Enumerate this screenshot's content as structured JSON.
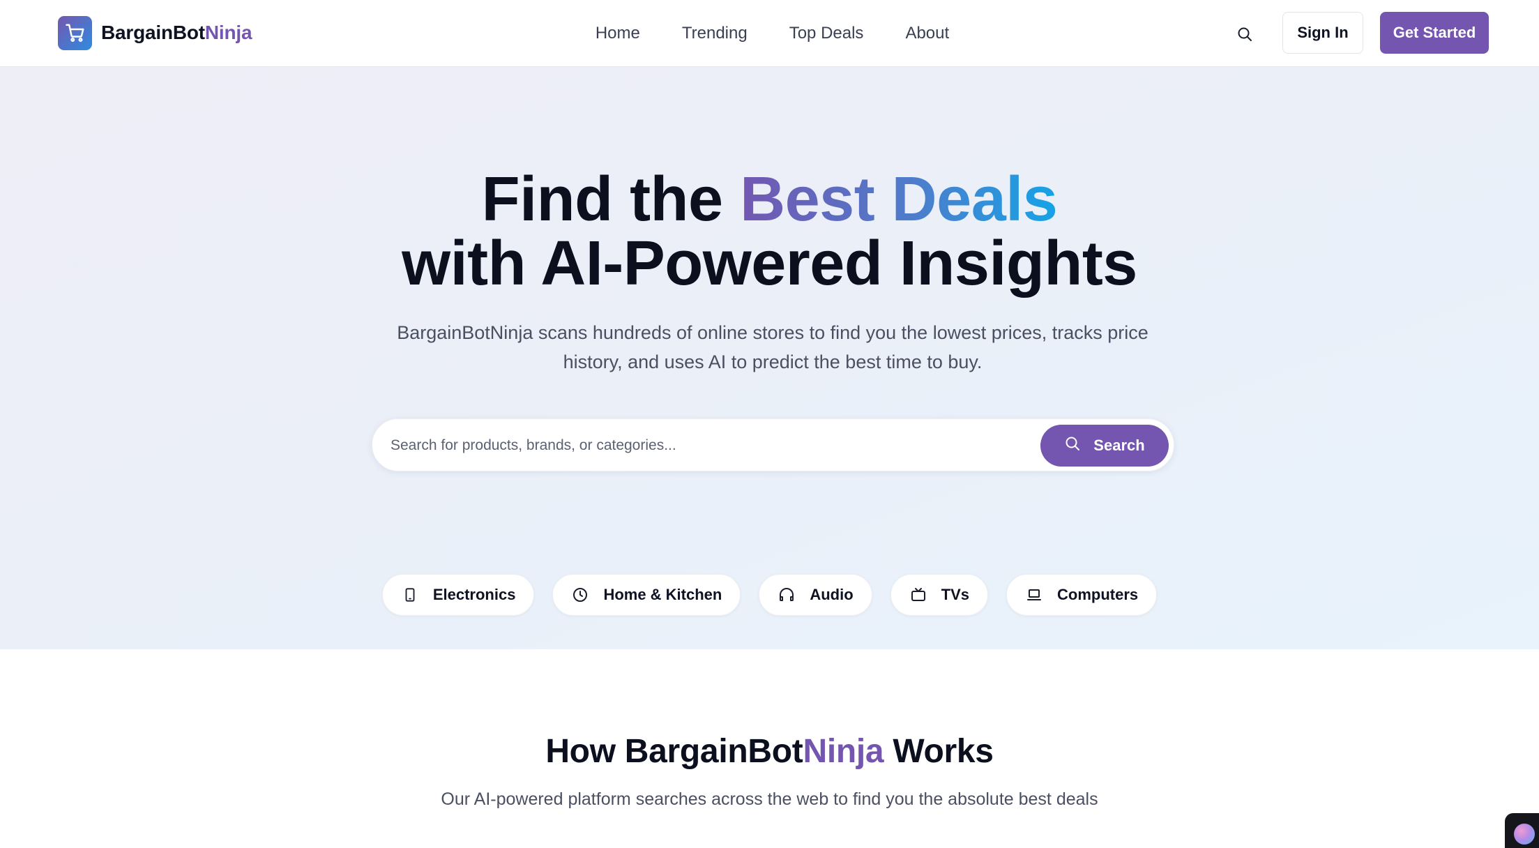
{
  "header": {
    "logo_primary": "BargainBot",
    "logo_accent": "Ninja",
    "nav": [
      "Home",
      "Trending",
      "Top Deals",
      "About"
    ],
    "sign_in": "Sign In",
    "get_started": "Get Started"
  },
  "hero": {
    "title_prefix": "Find the ",
    "title_highlight": "Best Deals",
    "title_line2": "with AI-Powered Insights",
    "subtitle": "BargainBotNinja scans hundreds of online stores to find you the lowest prices, tracks price history, and uses AI to predict the best time to buy.",
    "search_placeholder": "Search for products, brands, or categories...",
    "search_button": "Search",
    "categories": [
      {
        "label": "Electronics",
        "icon": "smartphone-icon"
      },
      {
        "label": "Home & Kitchen",
        "icon": "clock-icon"
      },
      {
        "label": "Audio",
        "icon": "headphones-icon"
      },
      {
        "label": "TVs",
        "icon": "tv-icon"
      },
      {
        "label": "Computers",
        "icon": "laptop-icon"
      }
    ]
  },
  "how": {
    "title_prefix": "How BargainBot",
    "title_accent": "Ninja",
    "title_suffix": " Works",
    "subtitle": "Our AI-powered platform searches across the web to find you the absolute best deals"
  },
  "colors": {
    "accent": "#7456b0",
    "gradient_start": "#7357b1",
    "gradient_end": "#16a3e6"
  }
}
